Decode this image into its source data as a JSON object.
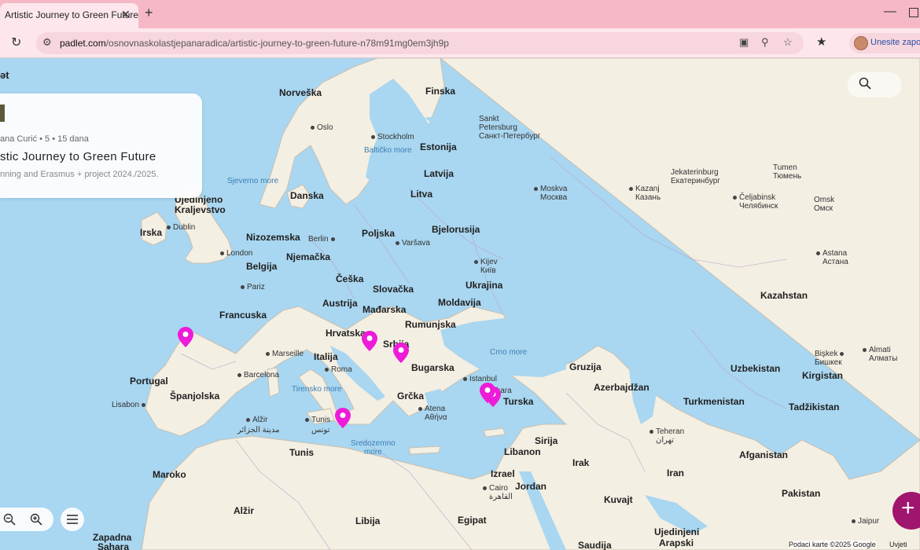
{
  "browser": {
    "tab_title": "Artistic Journey to Green Future",
    "tab_close": "✕",
    "new_tab": "+",
    "minimize": "—",
    "url_domain": "padlet.com",
    "url_path": "/osnovnaskolastjepanaradica/artistic-journey-to-green-future-n78m91mg0em3jh9p",
    "profile_label": "Unesite zapork"
  },
  "card": {
    "logo_fragment": "ət",
    "meta": "ana Curić • 5 • 15 dana",
    "title": "stic Journey to Green Future",
    "description": "nning and Erasmus + project 2024./2025."
  },
  "map": {
    "countries": [
      {
        "name": "Norveška"
      },
      {
        "name": "Finska"
      },
      {
        "name": "Estonija"
      },
      {
        "name": "Latvija"
      },
      {
        "name": "Litva"
      },
      {
        "name": "Danska"
      },
      {
        "name": "Ujedinjeno"
      },
      {
        "name": "Kraljevstvo"
      },
      {
        "name": "Irska"
      },
      {
        "name": "Nizozemska"
      },
      {
        "name": "Poljska"
      },
      {
        "name": "Bjelorusija"
      },
      {
        "name": "Belgija"
      },
      {
        "name": "Njemačka"
      },
      {
        "name": "Češka"
      },
      {
        "name": "Slovačka"
      },
      {
        "name": "Ukrajina"
      },
      {
        "name": "Francuska"
      },
      {
        "name": "Austrija"
      },
      {
        "name": "Mađarska"
      },
      {
        "name": "Moldavija"
      },
      {
        "name": "Rumunjska"
      },
      {
        "name": "Hrvatska"
      },
      {
        "name": "Srbija"
      },
      {
        "name": "Italija"
      },
      {
        "name": "Bugarska"
      },
      {
        "name": "Portugal"
      },
      {
        "name": "Španjolska"
      },
      {
        "name": "Grčka"
      },
      {
        "name": "Turska"
      },
      {
        "name": "Gruzija"
      },
      {
        "name": "Azerbajdžan"
      },
      {
        "name": "Kazahstan"
      },
      {
        "name": "Uzbekistan"
      },
      {
        "name": "Kirgistan"
      },
      {
        "name": "Turkmenistan"
      },
      {
        "name": "Tadžikistan"
      },
      {
        "name": "Sirija"
      },
      {
        "name": "Libanon"
      },
      {
        "name": "Irak"
      },
      {
        "name": "Iran"
      },
      {
        "name": "Afganistan"
      },
      {
        "name": "Izrael"
      },
      {
        "name": "Jordan"
      },
      {
        "name": "Kuvajt"
      },
      {
        "name": "Pakistan"
      },
      {
        "name": "Maroko"
      },
      {
        "name": "Alžir"
      },
      {
        "name": "Tunis"
      },
      {
        "name": "Libija"
      },
      {
        "name": "Egipat"
      },
      {
        "name": "Ujedinjeni"
      },
      {
        "name": "Arapski"
      },
      {
        "name": "Saudija"
      },
      {
        "name": "Zapadna"
      },
      {
        "name": "Sahara"
      }
    ],
    "cities": [
      {
        "name": "Oslo"
      },
      {
        "name": "Stockholm"
      },
      {
        "name": "Sankt"
      },
      {
        "name": "Petersburg"
      },
      {
        "name": "Санкт-Петербург"
      },
      {
        "name": "Jekaterinburg"
      },
      {
        "name": "Екатеринбург"
      },
      {
        "name": "Tumen"
      },
      {
        "name": "Тюмень"
      },
      {
        "name": "Moskva"
      },
      {
        "name": "Москва"
      },
      {
        "name": "Kazanj"
      },
      {
        "name": "Казань"
      },
      {
        "name": "Čeljabinsk"
      },
      {
        "name": "Челябинск"
      },
      {
        "name": "Omsk"
      },
      {
        "name": "Омск"
      },
      {
        "name": "Dublin"
      },
      {
        "name": "London"
      },
      {
        "name": "Berlin"
      },
      {
        "name": "Varšava"
      },
      {
        "name": "Kijev"
      },
      {
        "name": "Київ"
      },
      {
        "name": "Astana"
      },
      {
        "name": "Астана"
      },
      {
        "name": "Pariz"
      },
      {
        "name": "Marseille"
      },
      {
        "name": "Barcelona"
      },
      {
        "name": "Roma"
      },
      {
        "name": "Istanbul"
      },
      {
        "name": "Ankara"
      },
      {
        "name": "Bişkek"
      },
      {
        "name": "Бишкек"
      },
      {
        "name": "Almati"
      },
      {
        "name": "Алматы"
      },
      {
        "name": "Lisabon"
      },
      {
        "name": "Alžir"
      },
      {
        "name": "مدينة الجزائر"
      },
      {
        "name": "Tunis"
      },
      {
        "name": "تونس"
      },
      {
        "name": "Atena"
      },
      {
        "name": "Αθήνα"
      },
      {
        "name": "Teheran"
      },
      {
        "name": "تهران"
      },
      {
        "name": "Cairo"
      },
      {
        "name": "القاهرة"
      },
      {
        "name": "Jaipur"
      }
    ],
    "seas": [
      {
        "name": "Sjeverno more"
      },
      {
        "name": "Baltičko more"
      },
      {
        "name": "Crno more"
      },
      {
        "name": "Tirensko more"
      },
      {
        "name": "Sredozemno"
      },
      {
        "name": "more"
      }
    ],
    "pins": [
      {
        "place": "Spain - Galicia"
      },
      {
        "place": "Croatia"
      },
      {
        "place": "Serbia"
      },
      {
        "place": "Malta"
      },
      {
        "place": "Turkey 1"
      },
      {
        "place": "Turkey 2"
      }
    ],
    "pin_color": "#ee1bd9",
    "attribution": "Podaci karte ©2025 Google",
    "terms": "Uvjeti"
  },
  "colors": {
    "tabbar": "#f6b8c6",
    "toolbar": "#fde7ec",
    "water": "#a9d6f0",
    "land": "#f4efe3",
    "fab": "#a0156e"
  }
}
